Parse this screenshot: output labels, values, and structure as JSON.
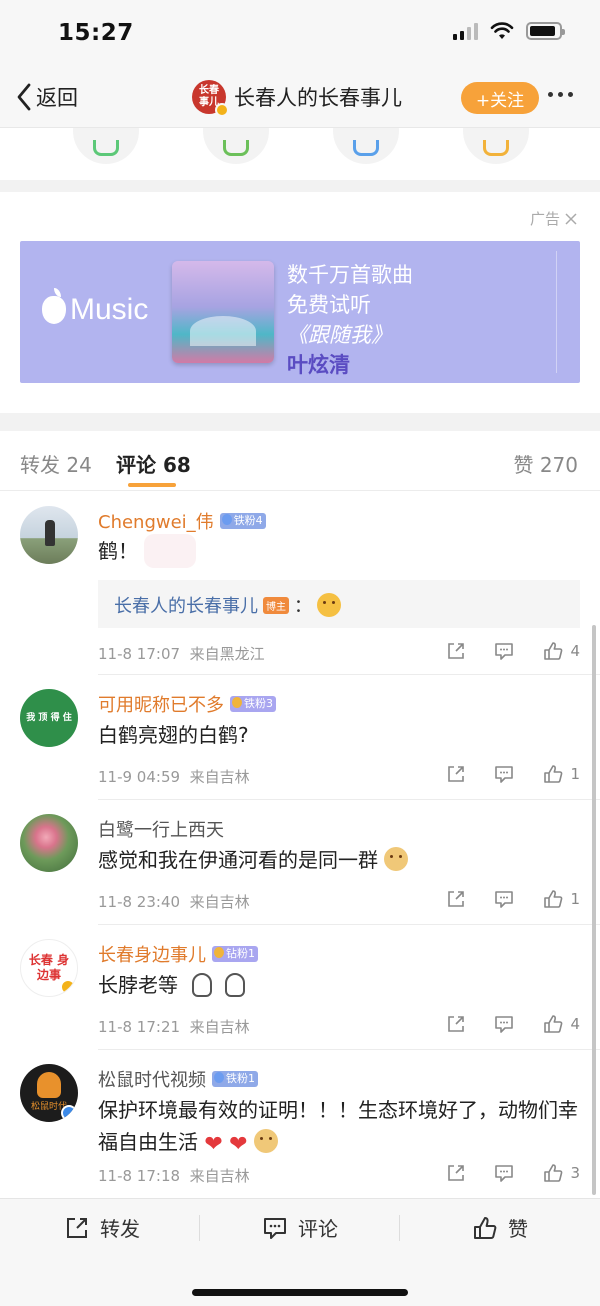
{
  "status": {
    "time": "15:27"
  },
  "nav": {
    "back_label": "返回",
    "avatar_text": "长春事儿",
    "title": "长春人的长春事儿",
    "follow_label": "+关注"
  },
  "ad": {
    "label": "广告",
    "brand": "Music",
    "lines": [
      "数千万首歌曲",
      "免费试听",
      "《跟随我》",
      "叶炫清"
    ]
  },
  "tabs": {
    "repost": "转发 24",
    "comment": "评论 68",
    "like": "赞 270"
  },
  "comments": [
    {
      "name": "Chengwei_伟",
      "badge": "铁粉4",
      "text": "鹤！",
      "reply_name": "长春人的长春事儿",
      "reply_tag": "博主",
      "reply_suffix": "：",
      "time": "11-8 17:07",
      "location": "来自黑龙江",
      "likes": "4"
    },
    {
      "name": "可用昵称已不多",
      "badge": "铁粉3",
      "avatar_text": "我 顶 得 住",
      "text": "白鹤亮翅的白鹤?",
      "time": "11-9 04:59",
      "location": "来自吉林",
      "likes": "1"
    },
    {
      "name": "白鹭一行上西天",
      "text": "感觉和我在伊通河看的是同一群",
      "time": "11-8 23:40",
      "location": "来自吉林",
      "likes": "1"
    },
    {
      "name": "长春身边事儿",
      "badge": "钻粉1",
      "avatar_text": "长春 身边事",
      "text": "长脖老等",
      "time": "11-8 17:21",
      "location": "来自吉林",
      "likes": "4"
    },
    {
      "name": "松鼠时代视频",
      "badge": "铁粉1",
      "avatar_text": "松鼠时代",
      "text": "保护环境最有效的证明！！！生态环境好了，动物们幸福自由生活",
      "time": "11-8 17:18",
      "location": "来自吉林",
      "likes": "3"
    }
  ],
  "bottom": {
    "repost": "转发",
    "comment": "评论",
    "like": "赞"
  },
  "colors": {
    "accent": "#f7a23a",
    "name": "#e07b2c",
    "ad_bg": "#b2b4ef"
  },
  "icons": [
    "chevron-left-icon",
    "share-icon",
    "comment-icon",
    "thumbs-up-icon",
    "close-icon",
    "apple-icon"
  ]
}
